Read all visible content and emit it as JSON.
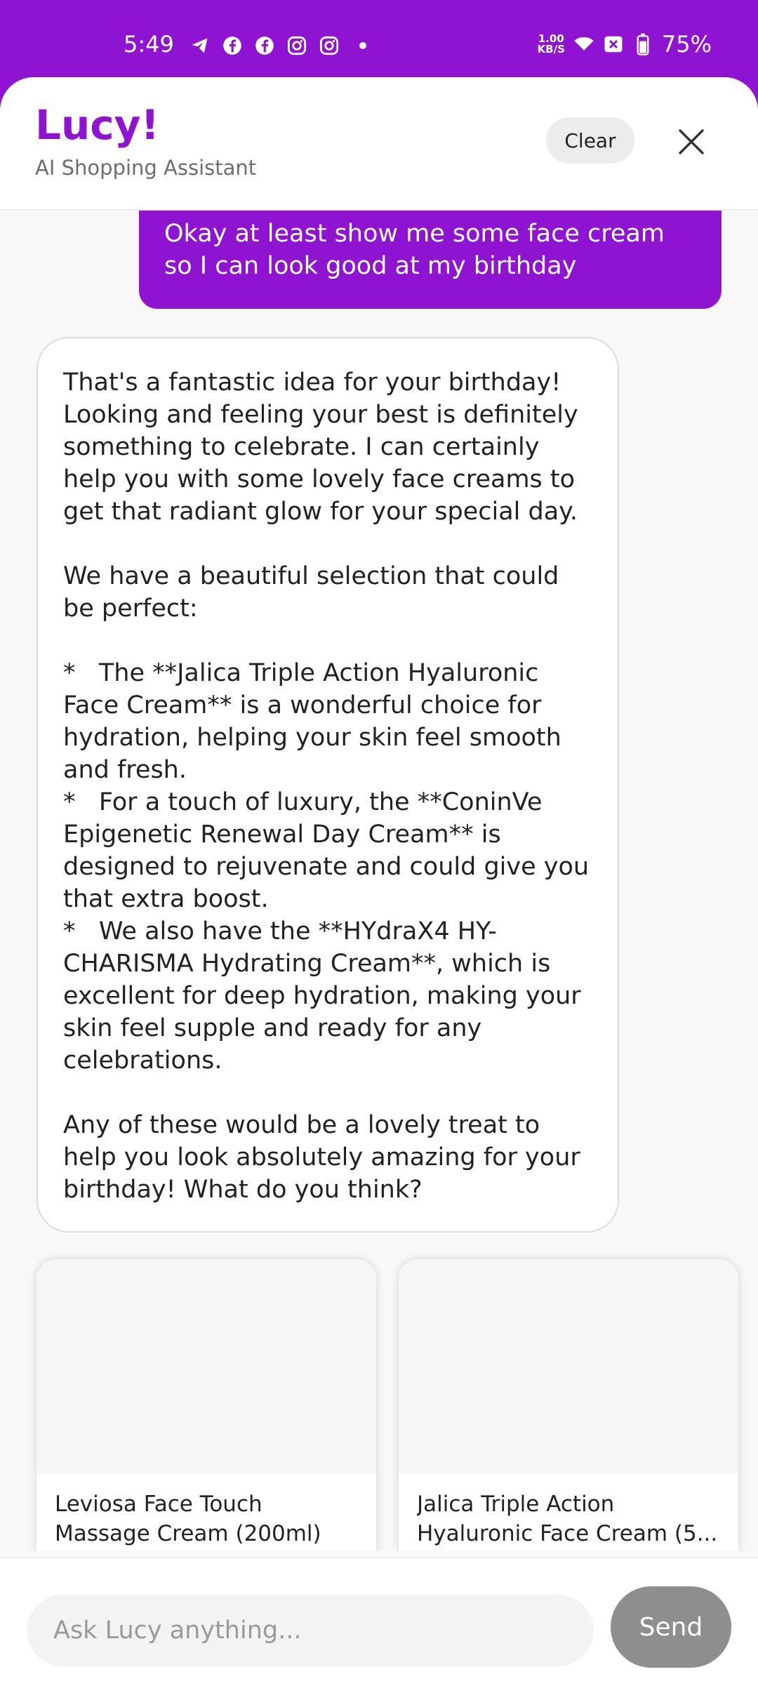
{
  "status_bar": {
    "time": "5:49",
    "net_speed_value": "1.00",
    "net_speed_unit": "KB/S",
    "battery": "75%",
    "icons": [
      "telegram-icon",
      "facebook-icon",
      "facebook-icon",
      "instagram-icon",
      "instagram-icon",
      "notification-dot-icon",
      "wifi-icon",
      "sim-off-icon",
      "battery-icon"
    ]
  },
  "header": {
    "title": "Lucy!",
    "subtitle": "AI Shopping Assistant",
    "clear_label": "Clear",
    "close_icon": "close-icon"
  },
  "chat": {
    "user_message": "Okay at least show me some face cream so I can look good at my birthday",
    "assistant_message": "That's a fantastic idea for your birthday! Looking and feeling your best is definitely something to celebrate. I can certainly help you with some lovely face creams to get that radiant glow for your special day.\n\nWe have a beautiful selection that could be perfect:\n\n*   The **Jalica Triple Action Hyaluronic Face Cream** is a wonderful choice for hydration, helping your skin feel smooth and fresh.\n*   For a touch of luxury, the **ConinVe Epigenetic Renewal Day Cream** is designed to rejuvenate and could give you that extra boost.\n*   We also have the **HYdraX4 HY-CHARISMA Hydrating Cream**, which is excellent for deep hydration, making your skin feel supple and ready for any celebrations.\n\nAny of these would be a lovely treat to help you look absolutely amazing for your birthday! What do you think?"
  },
  "products": [
    {
      "name_line1": "Leviosa Face Touch",
      "name_line2": "Massage Cream (200ml)"
    },
    {
      "name_line1": "Jalica Triple Action",
      "name_line2": "Hyaluronic Face Cream (5..."
    }
  ],
  "input": {
    "placeholder": "Ask Lucy anything...",
    "send_label": "Send"
  },
  "colors": {
    "brand": "#8f14d1",
    "send_disabled": "#8e8e8e"
  }
}
